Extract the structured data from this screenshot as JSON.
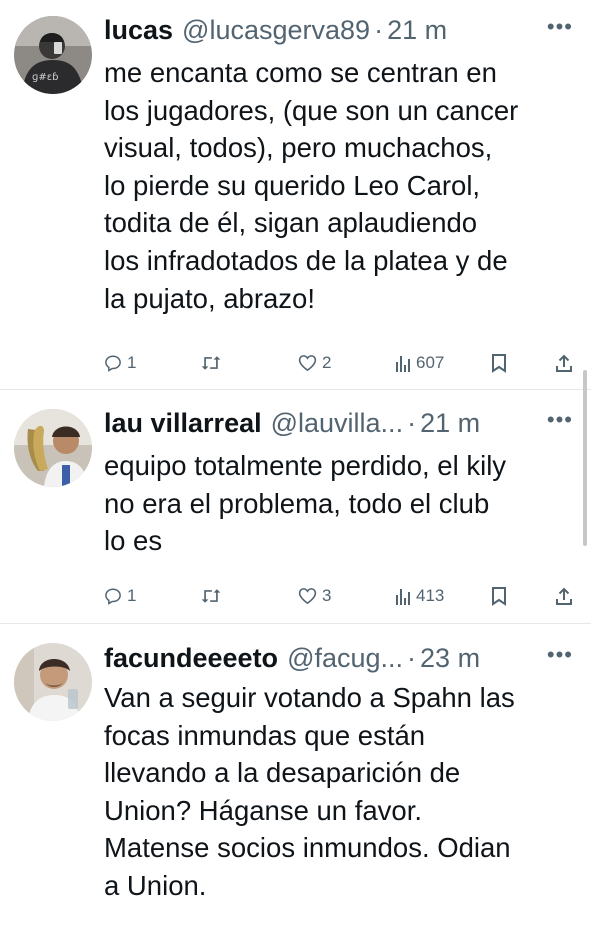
{
  "tweets": [
    {
      "name": "lucas",
      "handle": "@lucasgerva89",
      "time": "21 m",
      "text": "me encanta como se centran en\nlos jugadores, (que son un cancer\nvisual, todos), pero muchachos,\nlo pierde su querido Leo Carol,\ntodita de él, sigan aplaudiendo\nlos infradotados de la platea y de\nla pujato, abrazo!",
      "replies": "1",
      "retweets": "",
      "likes": "2",
      "views": "607",
      "more_icon": "more-dots-icon"
    },
    {
      "name": "lau villarreal",
      "handle": "@lauvilla...",
      "time": "21 m",
      "text": "equipo totalmente perdido, el kily\nno era el problema, todo el club\nlo es",
      "replies": "1",
      "retweets": "",
      "likes": "3",
      "views": "413",
      "more_icon": "more-dots-icon"
    },
    {
      "name": "facundeeeeto",
      "handle": "@facug...",
      "time": "23 m",
      "text": "Van a seguir votando a Spahn las\nfocas inmundas que están\nllevando a la desaparición de\nUnion? Háganse un favor.\nMatense socios inmundos. Odian\na Union.",
      "more_icon": "more-dots-icon"
    }
  ],
  "separator": "·",
  "colors": {
    "text": "#0f1419",
    "secondary": "#536471",
    "divider": "#e6e9ec"
  }
}
